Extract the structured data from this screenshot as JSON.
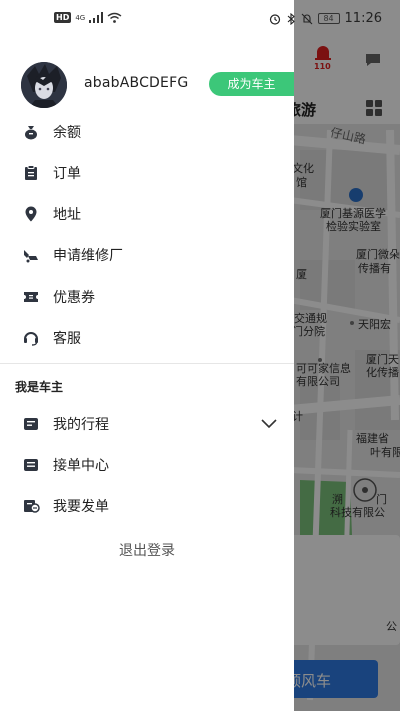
{
  "status_bar": {
    "hd": "HD",
    "network": "4G",
    "battery": "84",
    "time": "11:26"
  },
  "drawer": {
    "username": "ababABCDEFG",
    "become_owner_label": "成为车主",
    "menu": [
      {
        "label": "余额",
        "icon": "wallet-icon"
      },
      {
        "label": "订单",
        "icon": "clipboard-icon"
      },
      {
        "label": "地址",
        "icon": "location-pin-icon"
      },
      {
        "label": "申请维修厂",
        "icon": "wrench-icon"
      },
      {
        "label": "优惠券",
        "icon": "coupon-icon"
      },
      {
        "label": "客服",
        "icon": "headset-icon"
      }
    ],
    "owner_section_title": "我是车主",
    "owner_menu": [
      {
        "label": "我的行程",
        "icon": "itinerary-icon"
      },
      {
        "label": "接单中心",
        "icon": "order-center-icon"
      },
      {
        "label": "我要发单",
        "icon": "post-order-icon"
      }
    ],
    "logout_label": "退出登录"
  },
  "background": {
    "sos_label": "110",
    "tab_label": "旅游",
    "bottom_button": "顺风车",
    "map_labels": {
      "road_1": "仔山路",
      "l1": "文化",
      "l2": "馆",
      "l3": "厦门基源医学",
      "l4": "检验实验室",
      "l5": "厦门微朵",
      "l6": "传播有",
      "l7": "厦",
      "l8": "交通规",
      "l9": "门分院",
      "l10": "天阳宏",
      "l11": "厦门天",
      "l12": "化传播",
      "l13": "可可家信息",
      "l14": "有限公司",
      "l15": "计",
      "l16": "福建省",
      "l17": "叶有限",
      "l18": "溯",
      "l19": "门",
      "l20": "科技有限公",
      "l21": "公"
    }
  }
}
